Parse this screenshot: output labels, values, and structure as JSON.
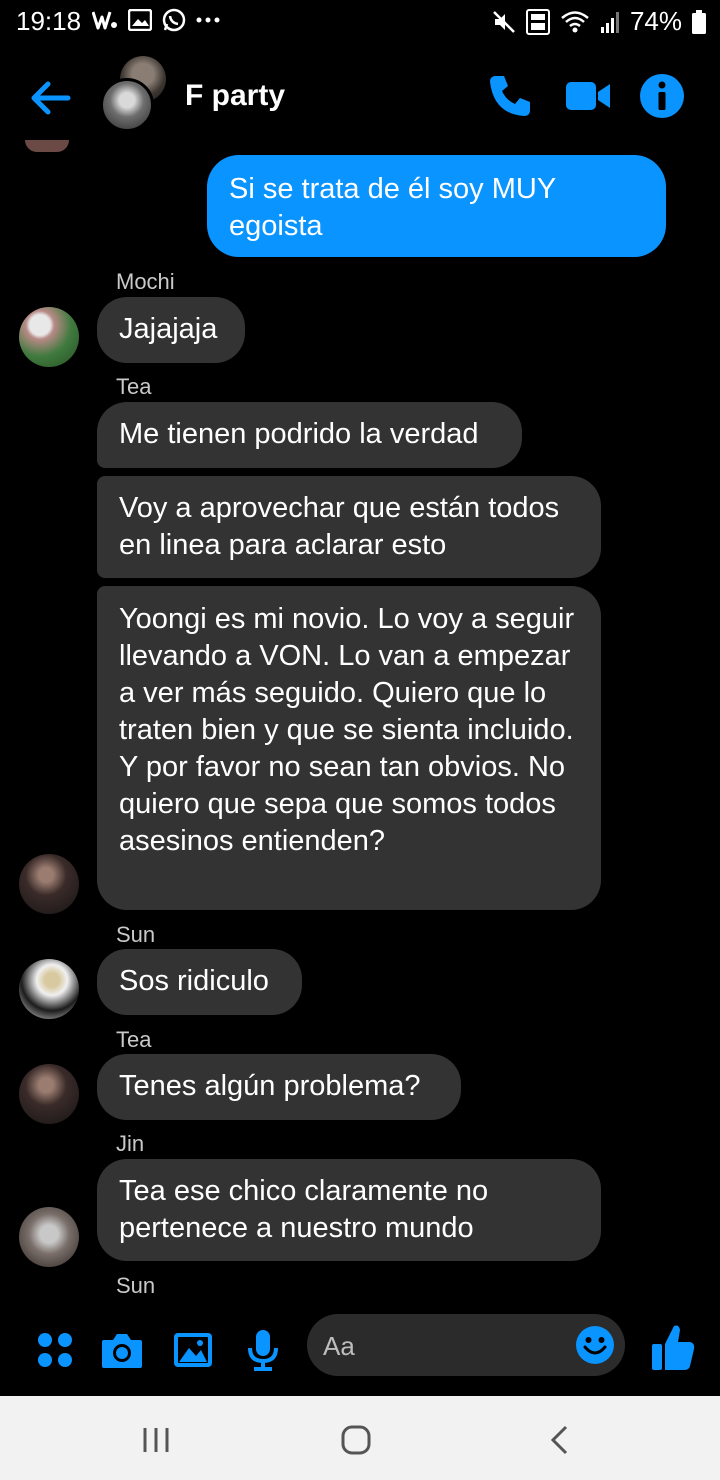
{
  "status_bar": {
    "time": "19:18",
    "battery": "74%",
    "icons": [
      "w-app-icon",
      "gallery-icon",
      "whatsapp-icon",
      "more-icon",
      "mute-icon",
      "volte-icon",
      "wifi-icon",
      "signal-icon",
      "battery-icon"
    ]
  },
  "header": {
    "title": "F party",
    "icons": [
      "back-arrow-icon",
      "phone-icon",
      "video-camera-icon",
      "info-icon"
    ]
  },
  "messages": {
    "m0": {
      "text": "Si se trata de él soy MUY egoista"
    },
    "m1": {
      "sender": "Mochi",
      "text": "Jajajaja"
    },
    "m2": {
      "sender": "Tea",
      "text": "Me tienen podrido la verdad"
    },
    "m3": {
      "text": "Voy a aprovechar que están todos en linea para aclarar esto"
    },
    "m4": {
      "text": "Yoongi es mi novio. Lo voy a seguir llevando a VON. Lo van a empezar a ver más seguido. Quiero que lo traten bien y que se sienta incluido. Y por favor no sean tan obvios. No quiero que sepa que somos todos asesinos entienden?"
    },
    "m5": {
      "sender": "Sun",
      "text": "Sos ridiculo"
    },
    "m6": {
      "sender": "Tea",
      "text": "Tenes algún problema?"
    },
    "m7": {
      "sender": "Jin",
      "text": "Tea ese chico claramente no pertenece a nuestro mundo"
    },
    "m8": {
      "sender": "Sun"
    }
  },
  "composer": {
    "placeholder": "Aa",
    "icons": [
      "apps-icon",
      "camera-icon",
      "image-icon",
      "microphone-icon",
      "emoji-icon",
      "thumbs-up-icon"
    ]
  },
  "nav_bar": {
    "icons": [
      "recent-apps-icon",
      "home-icon",
      "back-icon"
    ]
  },
  "colors": {
    "accent": "#0a94ff",
    "background": "#000000",
    "incoming_bubble": "#333333",
    "nav_bar": "#f2f2f2"
  }
}
